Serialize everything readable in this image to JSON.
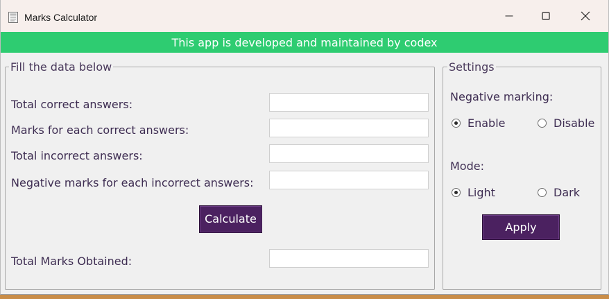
{
  "window": {
    "title": "Marks Calculator"
  },
  "banner": {
    "text": "This app is developed and maintained by codex"
  },
  "form": {
    "group_title": "Fill the data below",
    "fields": [
      {
        "label": "Total correct answers:",
        "value": ""
      },
      {
        "label": "Marks for each correct answers:",
        "value": ""
      },
      {
        "label": "Total incorrect answers:",
        "value": ""
      },
      {
        "label": "Negative marks for each incorrect answers:",
        "value": ""
      }
    ],
    "calculate_label": "Calculate",
    "result_label": "Total Marks Obtained:",
    "result_value": ""
  },
  "settings": {
    "group_title": "Settings",
    "negative_marking": {
      "label": "Negative marking:",
      "options": [
        "Enable",
        "Disable"
      ],
      "selected": "Enable"
    },
    "mode": {
      "label": "Mode:",
      "options": [
        "Light",
        "Dark"
      ],
      "selected": "Light"
    },
    "apply_label": "Apply"
  },
  "colors": {
    "banner": "#2ecc71",
    "button": "#4b2160",
    "label_text": "#3e2d52"
  }
}
